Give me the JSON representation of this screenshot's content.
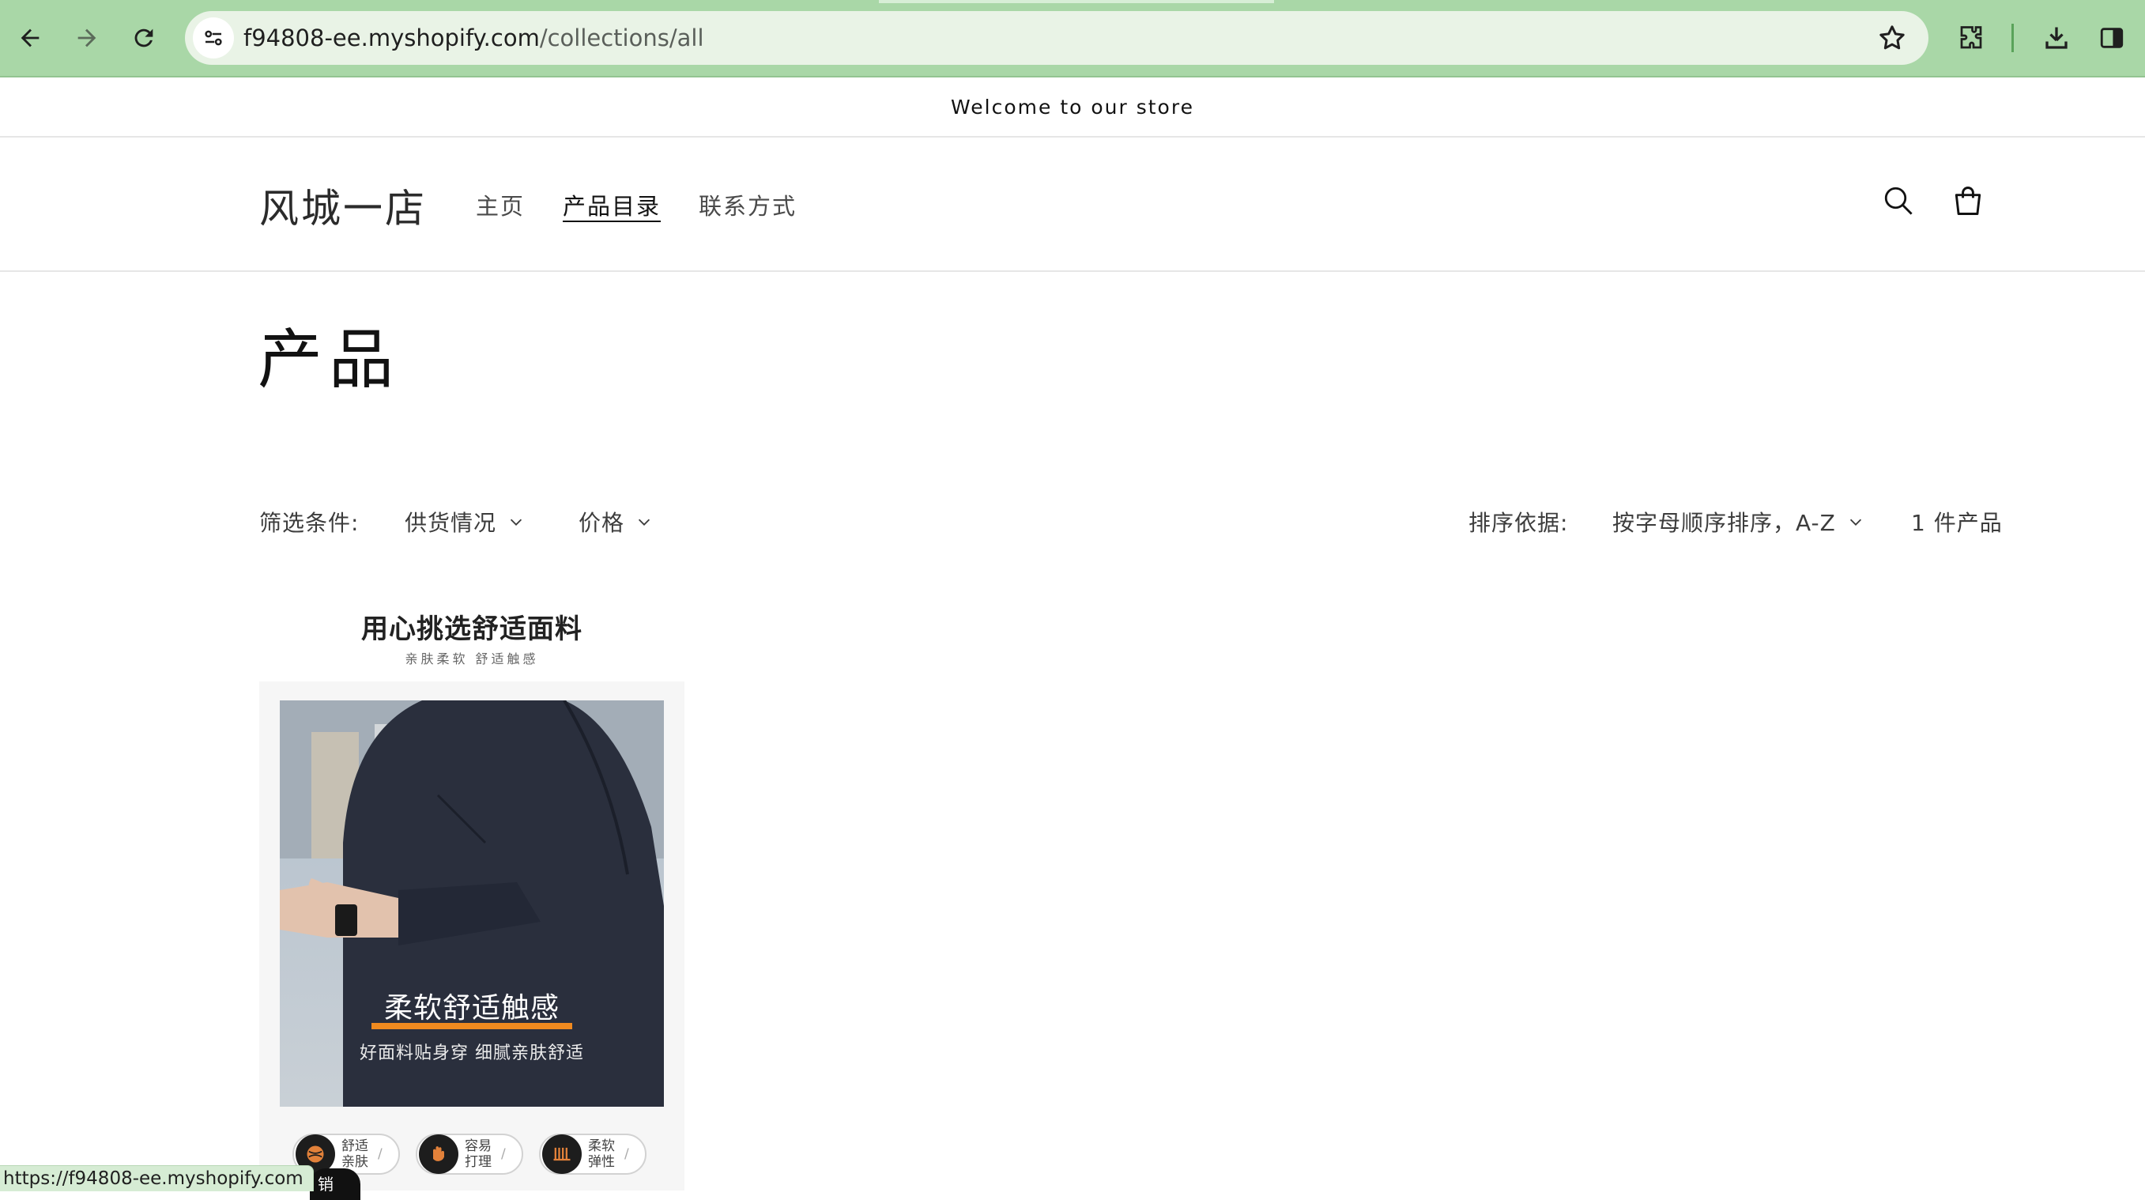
{
  "browser": {
    "url_host": "f94808-ee.myshopify.com",
    "url_path": "/collections/all",
    "status_url": "https://f94808-ee.myshopify.com"
  },
  "announcement": "Welcome to our store",
  "header": {
    "logo": "风城一店",
    "nav": [
      "主页",
      "产品目录",
      "联系方式"
    ]
  },
  "page": {
    "title": "产品"
  },
  "facets": {
    "filter_label": "筛选条件:",
    "filters": [
      "供货情况",
      "价格"
    ],
    "sort_label": "排序依据:",
    "sort_value": "按字母顺序排序，A-Z",
    "count": "1 件产品"
  },
  "product": {
    "headline": "用心挑选舒适面料",
    "subline": "亲肤柔软  舒适触感",
    "tagline": "柔软舒适触感",
    "tagline2": "好面料贴身穿 细腻亲肤舒适",
    "badges": [
      {
        "l1": "舒适",
        "l2": "亲肤"
      },
      {
        "l1": "容易",
        "l2": "打理"
      },
      {
        "l1": "柔软",
        "l2": "弹性"
      }
    ],
    "corner_badge": "销"
  },
  "colors": {
    "chrome": "#a9d7a7",
    "accent": "#f08a1f"
  }
}
